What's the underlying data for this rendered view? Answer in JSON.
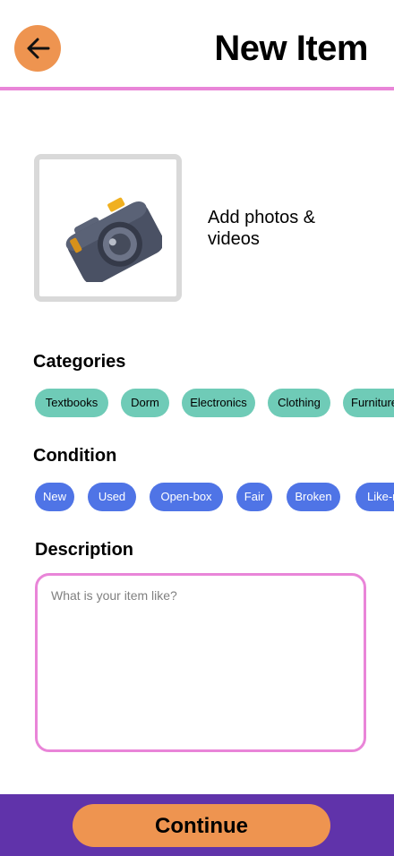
{
  "header": {
    "title": "New Item",
    "back_icon": "arrow-left-icon",
    "accent": "#ee9450",
    "rule_color": "#e985d8"
  },
  "media": {
    "label": "Add photos & videos",
    "icon": "camera-icon"
  },
  "categories": {
    "title": "Categories",
    "chip_color": "#6fcbb7",
    "items": [
      "Textbooks",
      "Dorm",
      "Electronics",
      "Clothing",
      "Furniture"
    ]
  },
  "condition": {
    "title": "Condition",
    "chip_color": "#4f74e6",
    "items": [
      "New",
      "Used",
      "Open-box",
      "Fair",
      "Broken",
      "Like-new"
    ]
  },
  "description": {
    "title": "Description",
    "placeholder": "What is your item like?"
  },
  "footer": {
    "continue_label": "Continue",
    "background": "#6033aa"
  }
}
